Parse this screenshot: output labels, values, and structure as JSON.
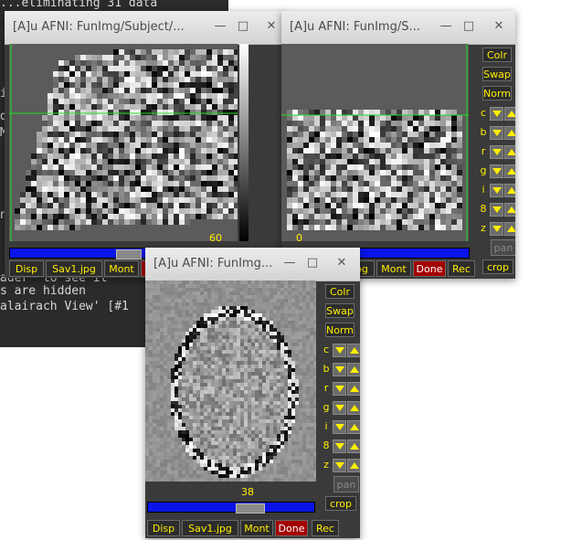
{
  "terminal": {
    "lines": [
      "...eliminating 31 data",
      "g",
      "n",
      "i",
      "d",
      "MP",
      "d",
      "",
      "st",
      "n",
      "",
      "",
      "ader' to see it",
      "s are hidden",
      "alairach View' [#1"
    ]
  },
  "windows": {
    "w1": {
      "title": "[A]u AFNI: FunImg/Subject/...",
      "slice": "60"
    },
    "w2": {
      "title": "[A]u AFNI: FunImg/S...",
      "slice": "0"
    },
    "w3": {
      "title": "[A]u AFNI: FunImg...",
      "slice": "38"
    }
  },
  "side": {
    "colr": "Colr",
    "swap": "Swap",
    "norm": "Norm",
    "rows": [
      "c",
      "b",
      "r",
      "g",
      "i",
      "8",
      "z"
    ],
    "pan": "pan",
    "crop": "crop"
  },
  "bottom": {
    "disp": "Disp",
    "sav": "Sav1.jpg",
    "mont": "Mont",
    "done": "Done",
    "rec": "Rec"
  },
  "colors": {
    "accent": "#ffee00",
    "slider": "#0a14e8",
    "done": "#a40000",
    "crosshair": "#22dd22"
  }
}
